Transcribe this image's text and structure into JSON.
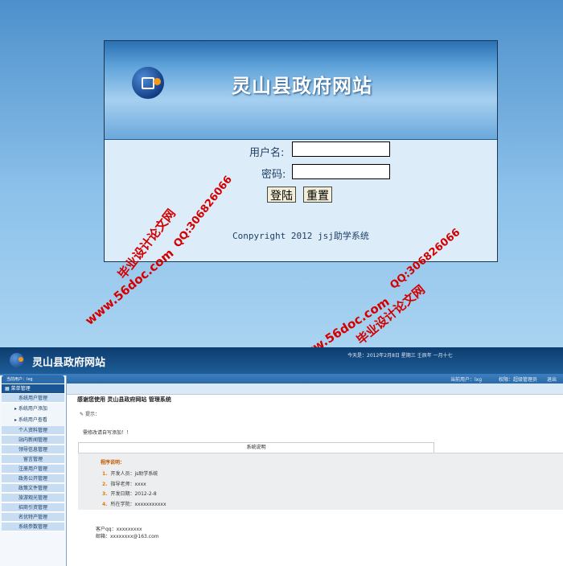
{
  "login": {
    "site_title": "灵山县政府网站",
    "username_label": "用户名:",
    "password_label": "密码:",
    "login_button": "登陆",
    "reset_button": "重置",
    "copyright": "Conpyright 2012 jsj助学系统"
  },
  "watermarks": {
    "qq": "QQ:306826066",
    "site_name": "毕业设计论文网",
    "url": "www.56doc.com"
  },
  "admin": {
    "site_title": "灵山县政府网站",
    "date_line": "今天是：2012年2月8日 星期三 壬辰年 一月十七",
    "current_user": "当前用户：lxg",
    "permission": "权限：超级管理员",
    "logout": "退出",
    "sidebar": {
      "user_line": "当前用户：lxg",
      "menu_head": "菜单管理",
      "items": [
        {
          "label": "系统用户管理",
          "type": "item"
        },
        {
          "label": "系统用户添加",
          "type": "sub"
        },
        {
          "label": "系统用户查看",
          "type": "sub"
        },
        {
          "label": "个人资料管理",
          "type": "item"
        },
        {
          "label": "站内新闻管理",
          "type": "item"
        },
        {
          "label": "领导信息管理",
          "type": "item"
        },
        {
          "label": "留言管理",
          "type": "item"
        },
        {
          "label": "注册用户管理",
          "type": "item"
        },
        {
          "label": "政务公开管理",
          "type": "item"
        },
        {
          "label": "政策文件管理",
          "type": "item"
        },
        {
          "label": "旅游观光管理",
          "type": "item"
        },
        {
          "label": "招商引资管理",
          "type": "item"
        },
        {
          "label": "名优特产管理",
          "type": "item"
        },
        {
          "label": "系统参数管理",
          "type": "item"
        }
      ]
    },
    "main": {
      "welcome": "感谢您使用 灵山县政府网站 管理系统",
      "tip_label": "提示：",
      "note": "需修改请自写添加！！",
      "system_heading": "系统说明",
      "program_heading": "程序说明：",
      "info_rows": [
        {
          "num": "1.",
          "text": "开发人员：js助学系统"
        },
        {
          "num": "2.",
          "text": "指导老师：xxxx"
        },
        {
          "num": "3.",
          "text": "开发日期：2012-2-8"
        },
        {
          "num": "4.",
          "text": "所在学院：xxxxxxxxxxx"
        }
      ],
      "contact": [
        "客户qq：xxxxxxxxx",
        "邮箱：xxxxxxxx@163.com"
      ]
    }
  }
}
